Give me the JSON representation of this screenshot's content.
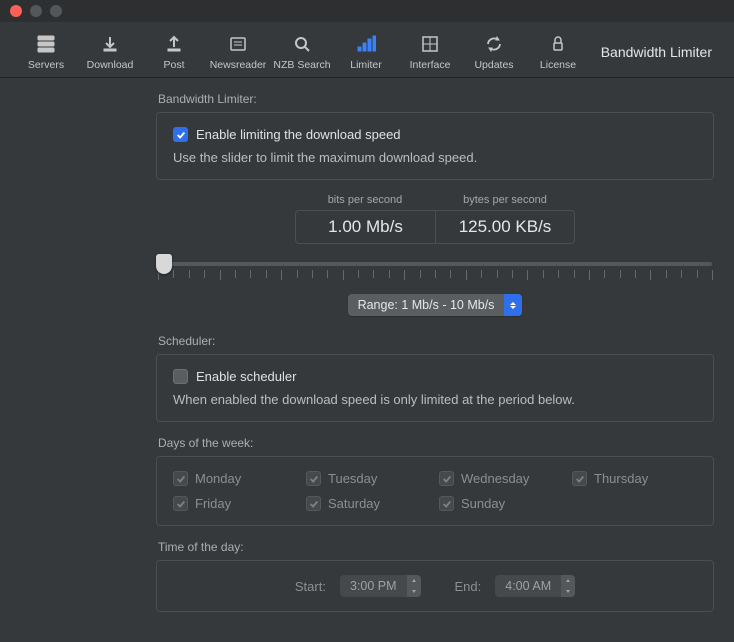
{
  "window": {
    "title": "Bandwidth Limiter"
  },
  "toolbar": {
    "items": [
      {
        "label": "Servers"
      },
      {
        "label": "Download"
      },
      {
        "label": "Post"
      },
      {
        "label": "Newsreader"
      },
      {
        "label": "NZB Search"
      },
      {
        "label": "Limiter"
      },
      {
        "label": "Interface"
      },
      {
        "label": "Updates"
      },
      {
        "label": "License"
      }
    ]
  },
  "limiter": {
    "section_label": "Bandwidth Limiter:",
    "enable_label": "Enable limiting the download speed",
    "enable_hint": "Use the slider to limit the maximum download speed.",
    "bits_header": "bits per second",
    "bytes_header": "bytes per second",
    "bits_value": "1.00 Mb/s",
    "bytes_value": "125.00 KB/s",
    "range_label": "Range: 1 Mb/s - 10 Mb/s"
  },
  "scheduler": {
    "section_label": "Scheduler:",
    "enable_label": "Enable scheduler",
    "enable_hint": "When enabled the download speed is only limited at the period below."
  },
  "days": {
    "section_label": "Days of the week:",
    "items": [
      "Monday",
      "Tuesday",
      "Wednesday",
      "Thursday",
      "Friday",
      "Saturday",
      "Sunday"
    ]
  },
  "time": {
    "section_label": "Time of the day:",
    "start_label": "Start:",
    "end_label": "End:",
    "start_value": "3:00 PM",
    "end_value": "4:00 AM"
  }
}
